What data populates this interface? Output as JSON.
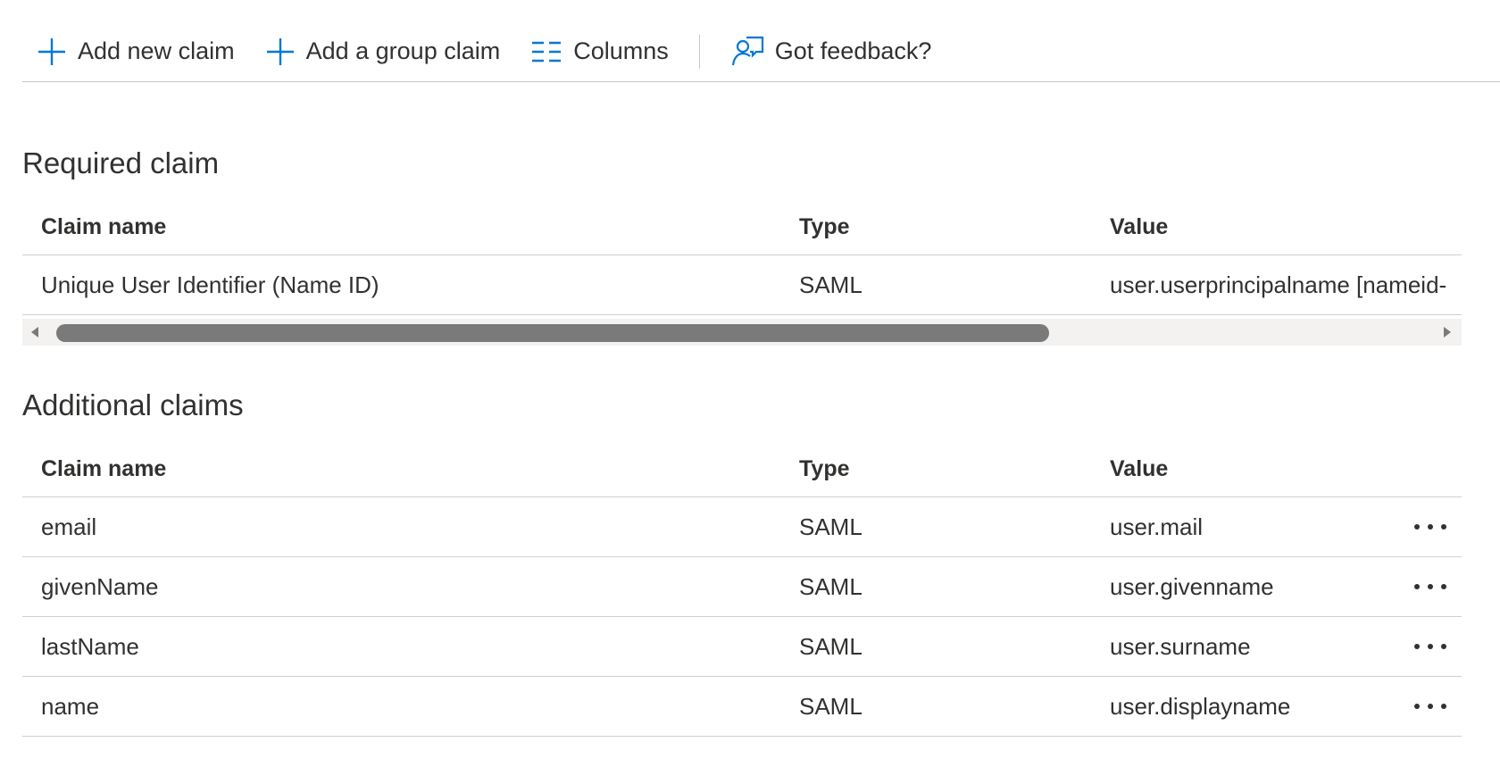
{
  "toolbar": {
    "add_new_claim": "Add new claim",
    "add_group_claim": "Add a group claim",
    "columns": "Columns",
    "feedback": "Got feedback?"
  },
  "colors": {
    "accent": "#0078d4",
    "text": "#323130",
    "divider": "#d2d0ce",
    "scroll_thumb": "#7a7a7a"
  },
  "required": {
    "title": "Required claim",
    "headers": {
      "name": "Claim name",
      "type": "Type",
      "value": "Value"
    },
    "rows": [
      {
        "name": "Unique User Identifier (Name ID)",
        "type": "SAML",
        "value": "user.userprincipalname [nameid-"
      }
    ]
  },
  "additional": {
    "title": "Additional claims",
    "headers": {
      "name": "Claim name",
      "type": "Type",
      "value": "Value"
    },
    "rows": [
      {
        "name": "email",
        "type": "SAML",
        "value": "user.mail"
      },
      {
        "name": "givenName",
        "type": "SAML",
        "value": "user.givenname"
      },
      {
        "name": "lastName",
        "type": "SAML",
        "value": "user.surname"
      },
      {
        "name": "name",
        "type": "SAML",
        "value": "user.displayname"
      }
    ]
  }
}
